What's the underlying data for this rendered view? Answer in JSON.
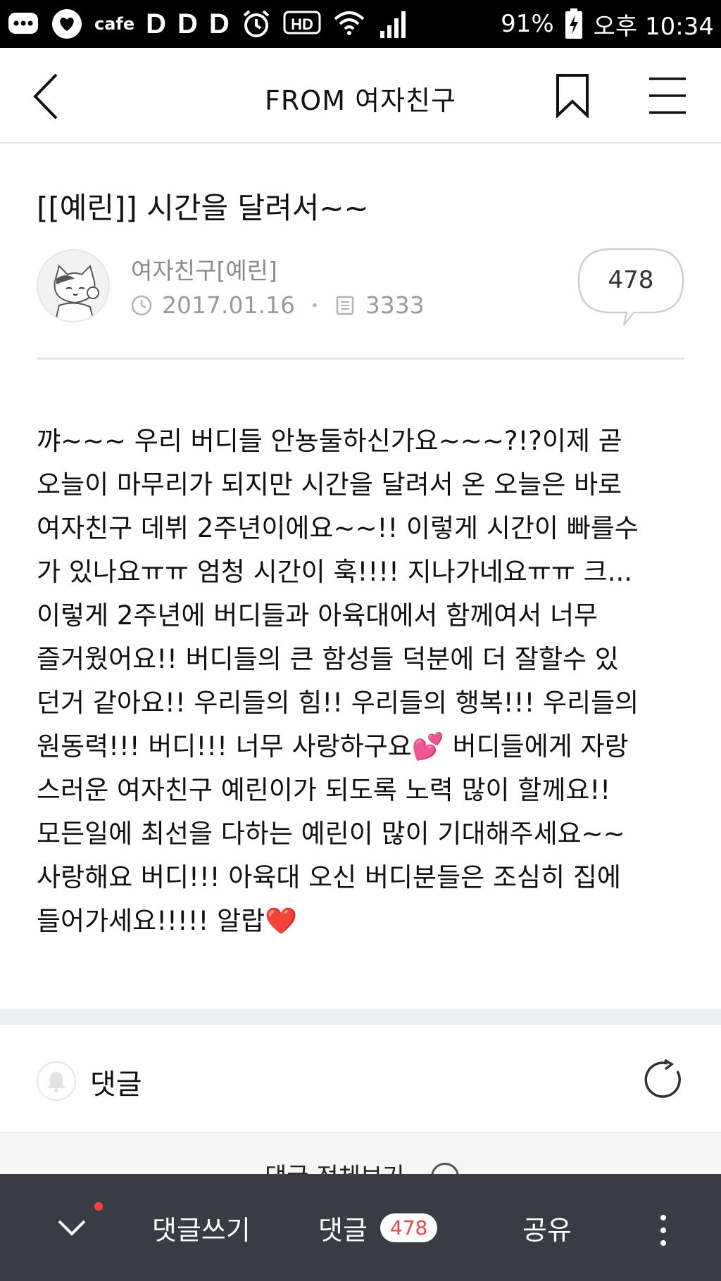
{
  "status_bar": {
    "cafe_label": "cafe",
    "d1": "D",
    "d2": "D",
    "d3": "D",
    "hd_label": "HD",
    "battery": "91%",
    "time": "오후 10:34"
  },
  "header": {
    "title": "FROM 여자친구"
  },
  "post": {
    "title": "[[예린]] 시간을 달려서~~",
    "author": "여자친구[예린]",
    "date": "2017.01.16",
    "views": "3333",
    "comment_count": "478",
    "body": "꺄~~~ 우리 버디들 안뇽둘하신가요~~~?!?이제 곧\n오늘이 마무리가 되지만 시간을 달려서 온 오늘은 바로\n여자친구 데뷔 2주년이에요~~!! 이렇게 시간이 빠를수\n가 있나요ㅠㅠ 엄청 시간이 훅!!!! 지나가네요ㅠㅠ 크...\n이렇게 2주년에 버디들과 아육대에서 함께여서 너무\n즐거웠어요!! 버디들의 큰 함성들 덕분에 더 잘할수 있\n던거 같아요!! 우리들의 힘!! 우리들의 행복!!! 우리들의\n원동력!!! 버디!!! 너무 사랑하구요💕 버디들에게 자랑\n스러운 여자친구 예린이가 되도록 노력 많이 할께요!!\n모든일에 최선을 다하는 예린이 많이 기대해주세요~~\n사랑해요 버디!!! 아육대 오신 버디분들은 조심히 집에\n들어가세요!!!!! 알랍❤️"
  },
  "comments": {
    "label": "댓글",
    "view_all": "댓글 전체보기"
  },
  "bottom_bar": {
    "write_comment": "댓글쓰기",
    "comments": "댓글",
    "comments_badge": "478",
    "share": "공유"
  }
}
